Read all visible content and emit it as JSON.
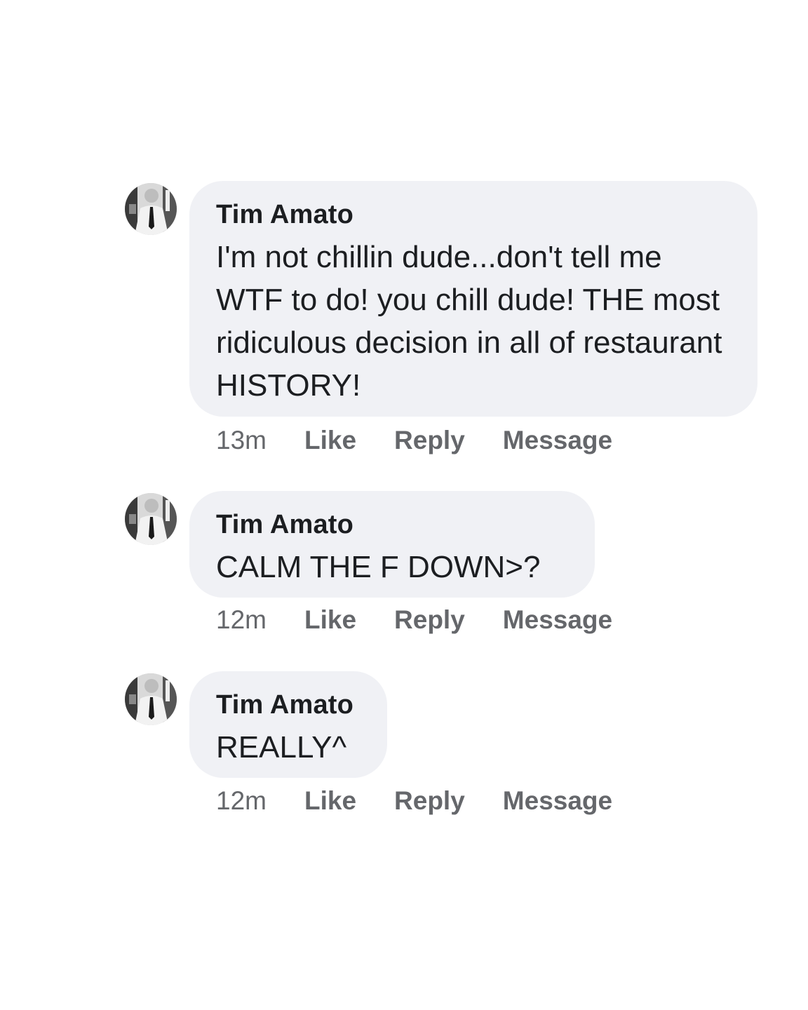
{
  "comments": [
    {
      "author": "Tim Amato",
      "text": "I'm not chillin dude...don't tell me WTF to do! you chill dude! THE most ridiculous decision in all of restaurant HISTORY!",
      "time": "13m",
      "like_label": "Like",
      "reply_label": "Reply",
      "message_label": "Message"
    },
    {
      "author": "Tim Amato",
      "text": "CALM THE F DOWN>?",
      "time": "12m",
      "like_label": "Like",
      "reply_label": "Reply",
      "message_label": "Message"
    },
    {
      "author": "Tim Amato",
      "text": "REALLY^",
      "time": "12m",
      "like_label": "Like",
      "reply_label": "Reply",
      "message_label": "Message"
    }
  ]
}
